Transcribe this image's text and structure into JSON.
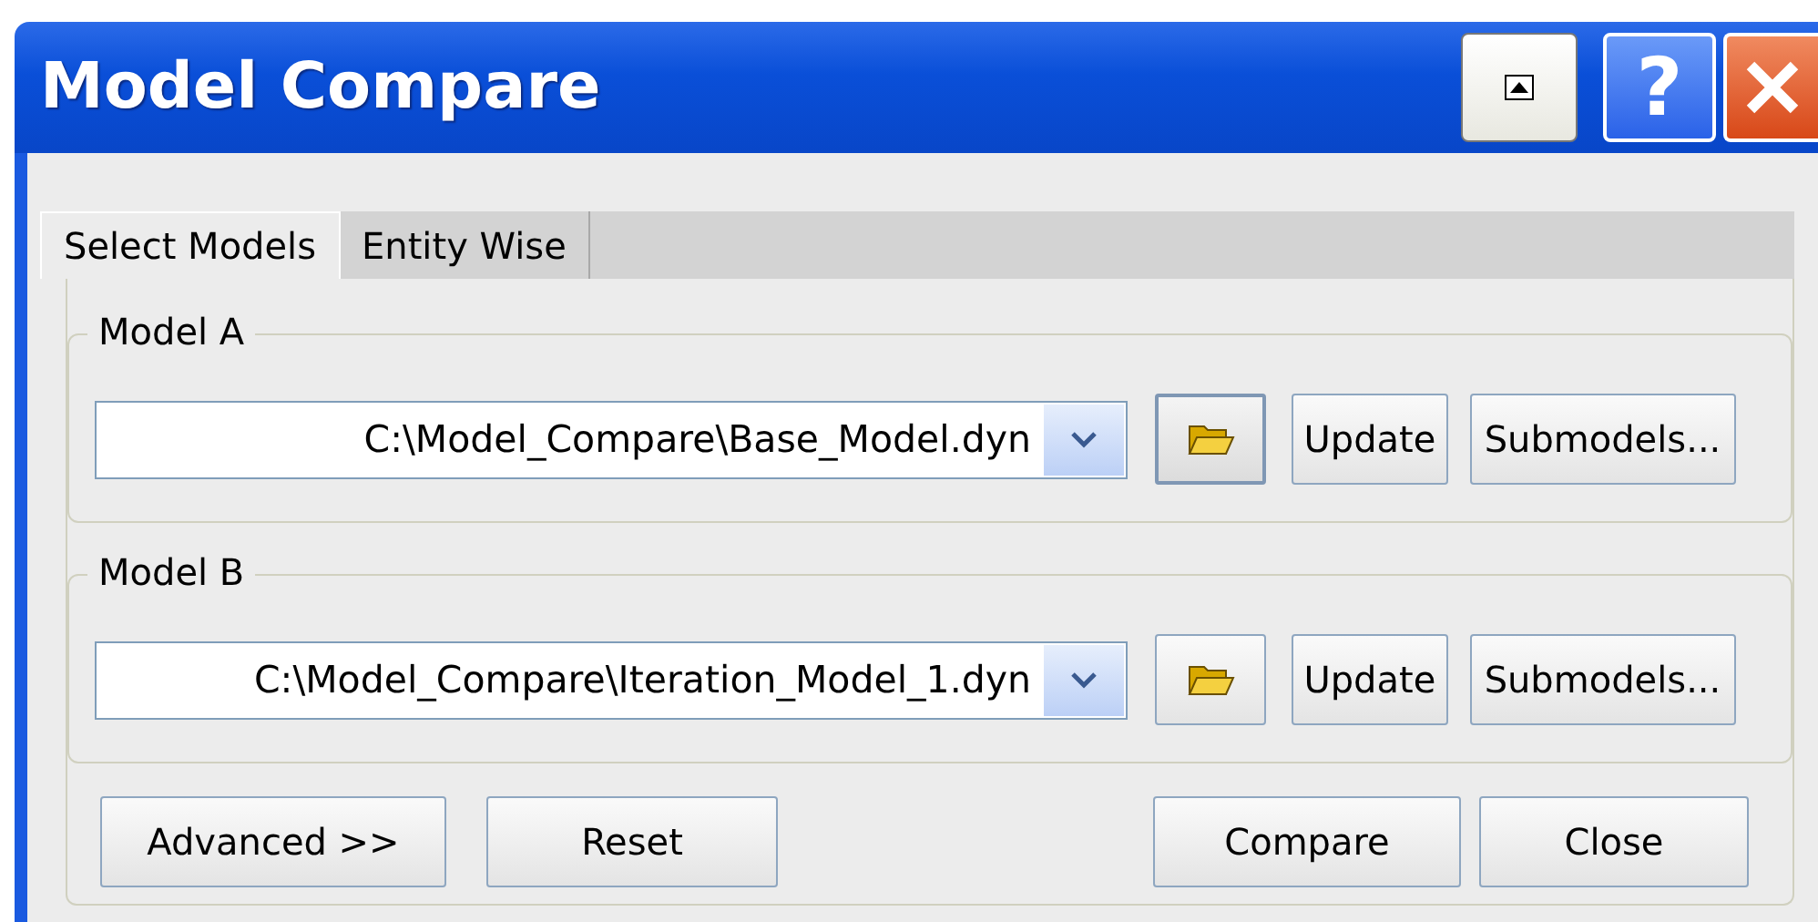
{
  "window": {
    "title": "Model Compare",
    "title_buttons": [
      {
        "kind": "rollup"
      },
      {
        "kind": "help",
        "label": "?"
      },
      {
        "kind": "close"
      }
    ]
  },
  "tabs": [
    {
      "label": "Select Models",
      "selected": true
    },
    {
      "label": "Entity Wise",
      "selected": false
    }
  ],
  "models": [
    {
      "legend": "Model A",
      "path": "C:\\Model_Compare\\Base_Model.dyn",
      "browse_focused": true,
      "update": "Update",
      "submodels": "Submodels..."
    },
    {
      "legend": "Model B",
      "path": "C:\\Model_Compare\\Iteration_Model_1.dyn",
      "browse_focused": false,
      "update": "Update",
      "submodels": "Submodels..."
    }
  ],
  "left_buttons": [
    "Advanced >>",
    "Reset"
  ],
  "right_buttons": [
    "Compare",
    "Close"
  ]
}
